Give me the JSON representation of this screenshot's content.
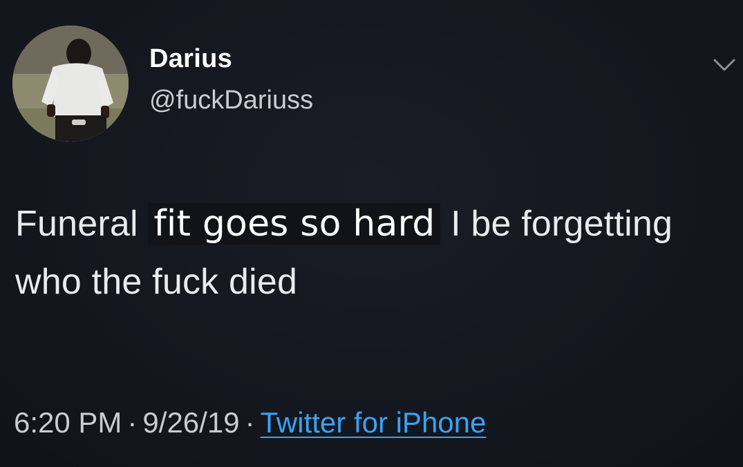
{
  "tweet": {
    "author": {
      "display_name": "Darius",
      "handle": "@fuckDariuss",
      "avatar_icon": "profile-photo"
    },
    "text_parts": [
      "Funeral",
      "fit goes so hard",
      "I be forgetting who the fuck died"
    ],
    "time": "6:20 PM",
    "separator": "·",
    "date": "9/26/19",
    "source": "Twitter for iPhone",
    "menu_icon": "chevron-down-icon"
  },
  "colors": {
    "background": "#15171f",
    "text": "#e9ebee",
    "secondary_text": "#c8cdd3",
    "link": "#3aa2f5"
  }
}
